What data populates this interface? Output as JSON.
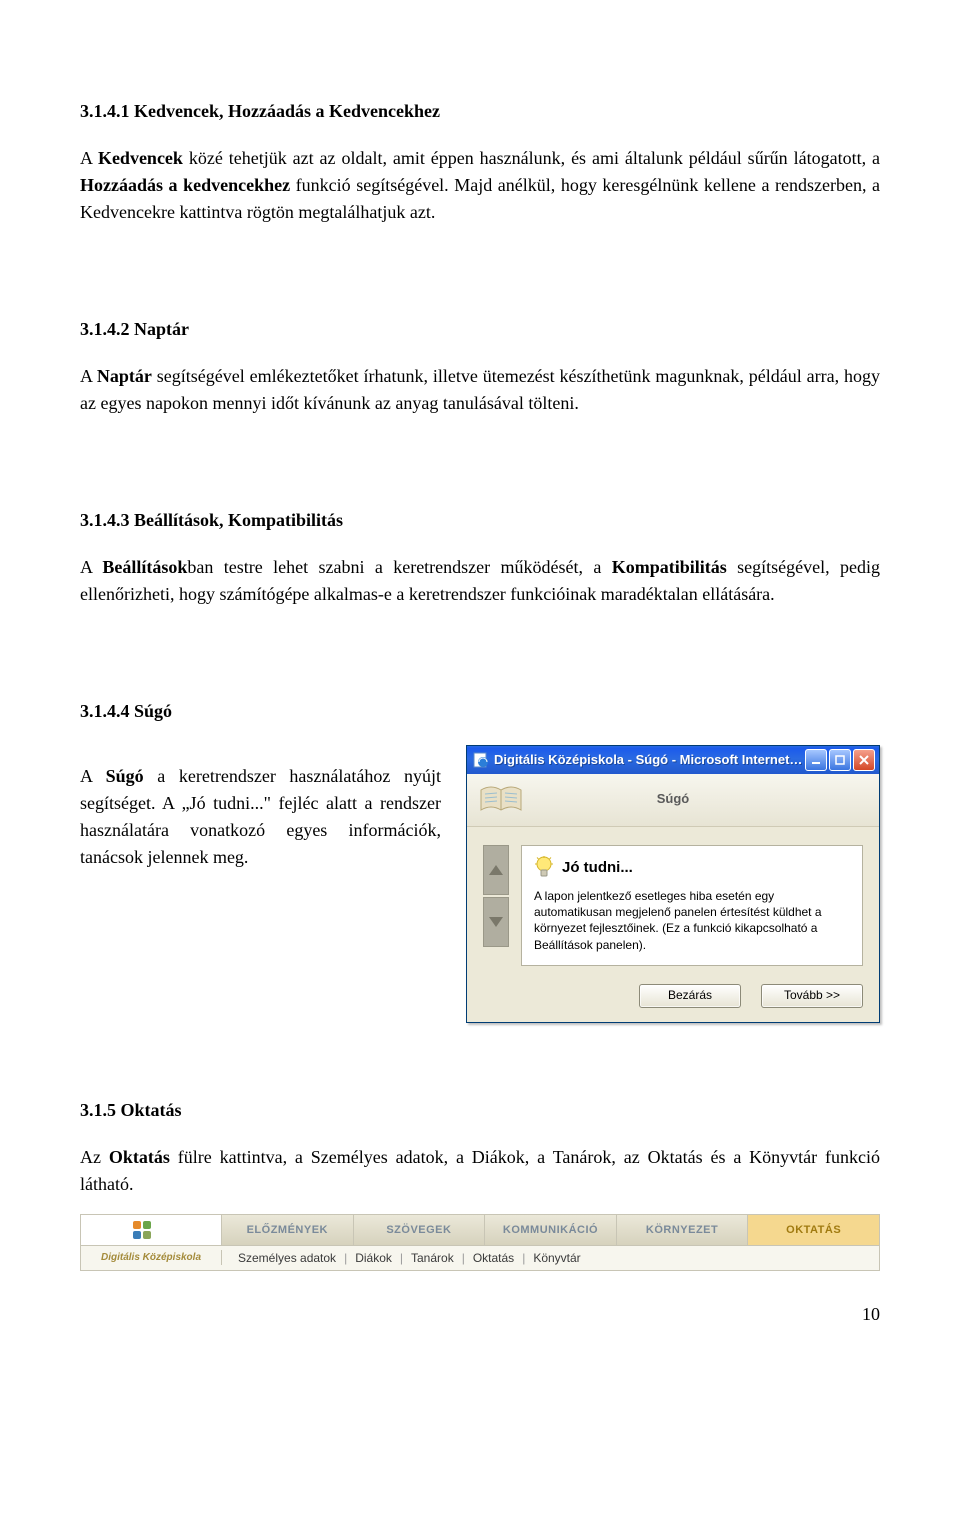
{
  "s1": {
    "heading": "3.1.4.1   Kedvencek, Hozzáadás a Kedvencekhez",
    "p1a": "A ",
    "p1b": "Kedvencek",
    "p1c": " közé tehetjük azt az oldalt, amit éppen használunk, és ami általunk például sűrűn látogatott, a ",
    "p1d": "Hozzáadás a kedvencekhez",
    "p1e": " funkció segítségével. Majd anélkül, hogy keresgélnünk kellene a rendszerben, a Kedvencekre kattintva rögtön megtalálhatjuk azt."
  },
  "s2": {
    "heading": "3.1.4.2   Naptár",
    "p1a": "A ",
    "p1b": "Naptár",
    "p1c": " segítségével emlékeztetőket írhatunk, illetve ütemezést készíthetünk magunknak, például arra, hogy az egyes napokon mennyi időt kívánunk az anyag tanulásával tölteni."
  },
  "s3": {
    "heading": "3.1.4.3   Beállítások, Kompatibilitás",
    "p1a": "A ",
    "p1b": "Beállítások",
    "p1c": "ban testre lehet szabni a keretrendszer működését, a ",
    "p1d": "Kompatibilitás",
    "p1e": " segítségével, pedig ellenőrizheti, hogy számítógépe alkalmas-e a keretrendszer funkcióinak maradéktalan ellátására."
  },
  "s4": {
    "heading": "3.1.4.4   Súgó",
    "p1a": "A ",
    "p1b": "Súgó",
    "p1c": " a keretrendszer használatához nyújt segítséget. A „Jó tudni...\" fejléc alatt a rendszer használatára vonatkozó egyes információk, tanácsok jelennek meg."
  },
  "help": {
    "title": "Digitális Középiskola - Súgó - Microsoft Internet Ex...",
    "header": "Súgó",
    "tipTitle": "Jó tudni...",
    "tipBody": "A lapon jelentkező esetleges hiba esetén egy automatikusan megjelenő panelen értesítést küldhet a környezet fejlesztőinek. (Ez a funkció kikapcsolható a Beállítások panelen).",
    "btnClose": "Bezárás",
    "btnNext": "Tovább >>"
  },
  "s5": {
    "heading": "3.1.5   Oktatás",
    "p1a": "Az ",
    "p1b": "Oktatás",
    "p1c": " fülre kattintva, a Személyes adatok, a Diákok, a Tanárok, az Oktatás és a Könyvtár funkció látható."
  },
  "nav": {
    "brand": "Digitális Középiskola",
    "tabs": [
      "ELŐZMÉNYEK",
      "SZÖVEGEK",
      "KOMMUNIKÁCIÓ",
      "KÖRNYEZET",
      "OKTATÁS"
    ],
    "sub": [
      "Személyes adatok",
      "Diákok",
      "Tanárok",
      "Oktatás",
      "Könyvtár"
    ]
  },
  "pageNumber": "10"
}
